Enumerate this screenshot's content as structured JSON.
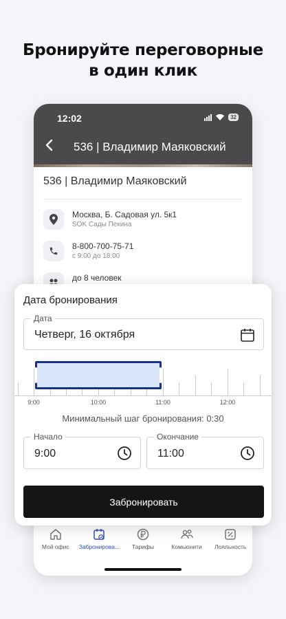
{
  "headline": {
    "line1": "Бронируйте переговорные",
    "line2": "в один клик"
  },
  "status_bar": {
    "time": "12:02",
    "battery": "32"
  },
  "nav": {
    "title": "536 | Владимир Маяковский"
  },
  "room": {
    "title": "536 | Владимир Маяковский",
    "address": "Москва, Б. Садовая ул. 5к1",
    "address_sub": "SOK Сады Пекина",
    "phone": "8-800-700-75-71",
    "phone_hours": "с 9:00 до 18:00",
    "capacity": "до 8 человек"
  },
  "sheet": {
    "title": "Дата бронирования",
    "date_label": "Дата",
    "date_value": "Четверг, 16 октября",
    "timeline_labels": [
      "9:00",
      "10:00",
      "11:00",
      "12:00"
    ],
    "selected_range": {
      "start": "9:00",
      "end": "11:00"
    },
    "min_step": "Минимальный шаг бронирования: 0:30",
    "start_label": "Начало",
    "start_value": "9:00",
    "end_label": "Окончание",
    "end_value": "11:00",
    "book_button": "Забронировать"
  },
  "tabs": [
    {
      "label": "Мой офис",
      "icon": "home-icon"
    },
    {
      "label": "Забронирова...",
      "icon": "calendar-check-icon",
      "active": true
    },
    {
      "label": "Тарифы",
      "icon": "ruble-icon"
    },
    {
      "label": "Комьюнити",
      "icon": "people-icon"
    },
    {
      "label": "Лояльность",
      "icon": "discount-icon"
    }
  ],
  "colors": {
    "accent": "#1a2f86",
    "selection_fill": "#dbe6fb",
    "header_bg": "#4a4a4c",
    "button_bg": "#151515"
  }
}
